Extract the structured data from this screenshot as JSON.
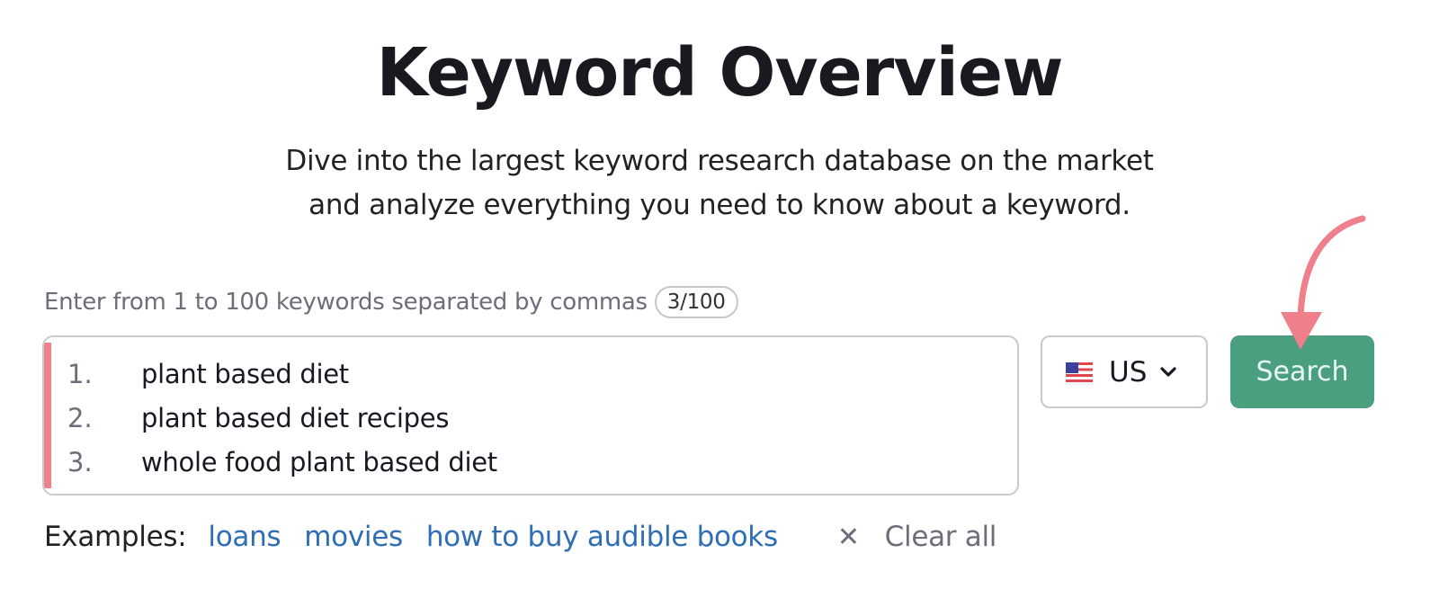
{
  "header": {
    "title": "Keyword Overview",
    "subtitle_line1": "Dive into the largest keyword research database on the market",
    "subtitle_line2": "and analyze everything you need to know about a keyword."
  },
  "input": {
    "hint": "Enter from 1 to 100 keywords separated by commas",
    "counter": "3/100",
    "keywords": [
      {
        "num": "1.",
        "text": "plant based diet"
      },
      {
        "num": "2.",
        "text": "plant based diet recipes"
      },
      {
        "num": "3.",
        "text": "whole food plant based diet"
      }
    ],
    "error_bar_color": "#ee7f8b"
  },
  "database": {
    "flag_icon": "us-flag-icon",
    "selected": "US"
  },
  "search_button": {
    "label": "Search",
    "color": "#4a9f7f"
  },
  "annotation": {
    "arrow_color": "#ee7f8b"
  },
  "examples": {
    "label": "Examples:",
    "links": [
      "loans",
      "movies",
      "how to buy audible books"
    ],
    "link_color": "#2f6db5"
  },
  "clear_all": {
    "icon": "close-icon",
    "label": "Clear all"
  }
}
